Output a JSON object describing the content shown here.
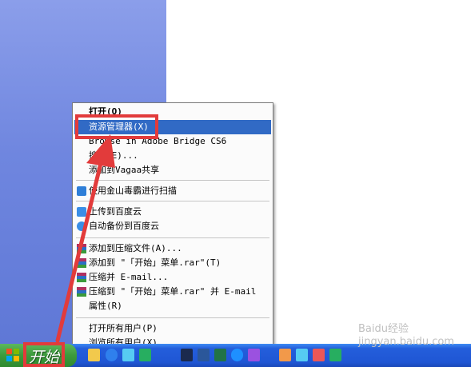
{
  "menu": {
    "items": [
      {
        "label": "打开(O)",
        "bold": true,
        "icon": "none"
      },
      {
        "label": "资源管理器(X)",
        "highlighted": true,
        "icon": "none"
      },
      {
        "label": "Browse in Adobe Bridge CS6",
        "icon": "none"
      },
      {
        "label": "搜索(E)...",
        "icon": "none"
      },
      {
        "label": "添加到Vagaa共享",
        "icon": "none"
      },
      {
        "label": "使用金山毒霸进行扫描",
        "icon": "kingsoft-icon"
      },
      {
        "label": "上传到百度云",
        "icon": "baidu-cloud-icon"
      },
      {
        "label": "自动备份到百度云",
        "icon": "baidu-backup-icon"
      },
      {
        "label": "添加到压缩文件(A)...",
        "icon": "winrar-icon"
      },
      {
        "label": "添加到 \"「开始」菜单.rar\"(T)",
        "icon": "winrar-icon"
      },
      {
        "label": "压缩并 E-mail...",
        "icon": "winrar-icon"
      },
      {
        "label": "压缩到 \"「开始」菜单.rar\" 并 E-mail",
        "icon": "winrar-icon"
      },
      {
        "label": "属性(R)",
        "icon": "none"
      },
      {
        "label": "打开所有用户(P)",
        "icon": "none"
      },
      {
        "label": "浏览所有用户(X)",
        "icon": "none"
      }
    ]
  },
  "taskbar": {
    "start_label": "开始"
  },
  "watermark": "Baidu经验 jingyan.baidu.com",
  "colors": {
    "highlight": "#316ac5",
    "annotation_red": "#e23b3b",
    "taskbar_blue": "#245edb",
    "start_green": "#3c9a3c"
  }
}
